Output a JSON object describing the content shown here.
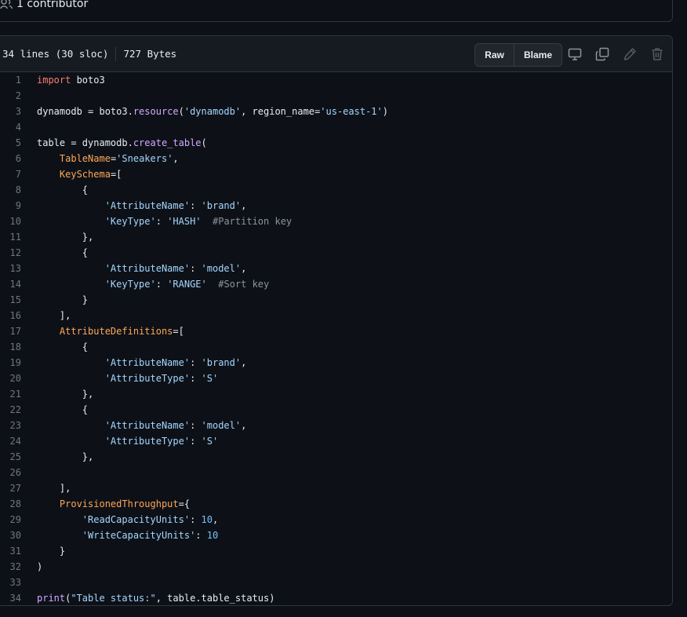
{
  "contributors": {
    "text": "1 contributor"
  },
  "file_header": {
    "lines": "34 lines (30 sloc)",
    "size": "727 Bytes",
    "raw_label": "Raw",
    "blame_label": "Blame",
    "icons": [
      "desktop-icon",
      "copy-icon",
      "pencil-icon",
      "trash-icon"
    ]
  },
  "code_lines": [
    {
      "n": "1",
      "t": [
        {
          "c": "kw",
          "v": "import"
        },
        {
          "c": "",
          "v": " boto3"
        }
      ]
    },
    {
      "n": "2",
      "t": []
    },
    {
      "n": "3",
      "t": [
        {
          "c": "",
          "v": "dynamodb = boto3."
        },
        {
          "c": "fn",
          "v": "resource"
        },
        {
          "c": "",
          "v": "("
        },
        {
          "c": "str",
          "v": "'dynamodb'"
        },
        {
          "c": "",
          "v": ", region_name="
        },
        {
          "c": "str",
          "v": "'us-east-1'"
        },
        {
          "c": "",
          "v": ")"
        }
      ]
    },
    {
      "n": "4",
      "t": []
    },
    {
      "n": "5",
      "t": [
        {
          "c": "",
          "v": "table = dynamodb."
        },
        {
          "c": "fn",
          "v": "create_table"
        },
        {
          "c": "",
          "v": "("
        }
      ]
    },
    {
      "n": "6",
      "t": [
        {
          "c": "",
          "v": "    "
        },
        {
          "c": "param",
          "v": "TableName"
        },
        {
          "c": "",
          "v": "="
        },
        {
          "c": "str",
          "v": "'Sneakers'"
        },
        {
          "c": "",
          "v": ","
        }
      ]
    },
    {
      "n": "7",
      "t": [
        {
          "c": "",
          "v": "    "
        },
        {
          "c": "param",
          "v": "KeySchema"
        },
        {
          "c": "",
          "v": "=["
        }
      ]
    },
    {
      "n": "8",
      "t": [
        {
          "c": "",
          "v": "        {"
        }
      ]
    },
    {
      "n": "9",
      "t": [
        {
          "c": "",
          "v": "            "
        },
        {
          "c": "str",
          "v": "'AttributeName'"
        },
        {
          "c": "",
          "v": ": "
        },
        {
          "c": "str",
          "v": "'brand'"
        },
        {
          "c": "",
          "v": ","
        }
      ]
    },
    {
      "n": "10",
      "t": [
        {
          "c": "",
          "v": "            "
        },
        {
          "c": "str",
          "v": "'KeyType'"
        },
        {
          "c": "",
          "v": ": "
        },
        {
          "c": "str",
          "v": "'HASH'"
        },
        {
          "c": "",
          "v": "  "
        },
        {
          "c": "cm",
          "v": "#Partition key"
        }
      ]
    },
    {
      "n": "11",
      "t": [
        {
          "c": "",
          "v": "        },"
        }
      ]
    },
    {
      "n": "12",
      "t": [
        {
          "c": "",
          "v": "        {"
        }
      ]
    },
    {
      "n": "13",
      "t": [
        {
          "c": "",
          "v": "            "
        },
        {
          "c": "str",
          "v": "'AttributeName'"
        },
        {
          "c": "",
          "v": ": "
        },
        {
          "c": "str",
          "v": "'model'"
        },
        {
          "c": "",
          "v": ","
        }
      ]
    },
    {
      "n": "14",
      "t": [
        {
          "c": "",
          "v": "            "
        },
        {
          "c": "str",
          "v": "'KeyType'"
        },
        {
          "c": "",
          "v": ": "
        },
        {
          "c": "str",
          "v": "'RANGE'"
        },
        {
          "c": "",
          "v": "  "
        },
        {
          "c": "cm",
          "v": "#Sort key"
        }
      ]
    },
    {
      "n": "15",
      "t": [
        {
          "c": "",
          "v": "        }"
        }
      ]
    },
    {
      "n": "16",
      "t": [
        {
          "c": "",
          "v": "    ],"
        }
      ]
    },
    {
      "n": "17",
      "t": [
        {
          "c": "",
          "v": "    "
        },
        {
          "c": "param",
          "v": "AttributeDefinitions"
        },
        {
          "c": "",
          "v": "=["
        }
      ]
    },
    {
      "n": "18",
      "t": [
        {
          "c": "",
          "v": "        {"
        }
      ]
    },
    {
      "n": "19",
      "t": [
        {
          "c": "",
          "v": "            "
        },
        {
          "c": "str",
          "v": "'AttributeName'"
        },
        {
          "c": "",
          "v": ": "
        },
        {
          "c": "str",
          "v": "'brand'"
        },
        {
          "c": "",
          "v": ","
        }
      ]
    },
    {
      "n": "20",
      "t": [
        {
          "c": "",
          "v": "            "
        },
        {
          "c": "str",
          "v": "'AttributeType'"
        },
        {
          "c": "",
          "v": ": "
        },
        {
          "c": "str",
          "v": "'S'"
        }
      ]
    },
    {
      "n": "21",
      "t": [
        {
          "c": "",
          "v": "        },"
        }
      ]
    },
    {
      "n": "22",
      "t": [
        {
          "c": "",
          "v": "        {"
        }
      ]
    },
    {
      "n": "23",
      "t": [
        {
          "c": "",
          "v": "            "
        },
        {
          "c": "str",
          "v": "'AttributeName'"
        },
        {
          "c": "",
          "v": ": "
        },
        {
          "c": "str",
          "v": "'model'"
        },
        {
          "c": "",
          "v": ","
        }
      ]
    },
    {
      "n": "24",
      "t": [
        {
          "c": "",
          "v": "            "
        },
        {
          "c": "str",
          "v": "'AttributeType'"
        },
        {
          "c": "",
          "v": ": "
        },
        {
          "c": "str",
          "v": "'S'"
        }
      ]
    },
    {
      "n": "25",
      "t": [
        {
          "c": "",
          "v": "        },"
        }
      ]
    },
    {
      "n": "26",
      "t": []
    },
    {
      "n": "27",
      "t": [
        {
          "c": "",
          "v": "    ],"
        }
      ]
    },
    {
      "n": "28",
      "t": [
        {
          "c": "",
          "v": "    "
        },
        {
          "c": "param",
          "v": "ProvisionedThroughput"
        },
        {
          "c": "",
          "v": "={"
        }
      ]
    },
    {
      "n": "29",
      "t": [
        {
          "c": "",
          "v": "        "
        },
        {
          "c": "str",
          "v": "'ReadCapacityUnits'"
        },
        {
          "c": "",
          "v": ": "
        },
        {
          "c": "num",
          "v": "10"
        },
        {
          "c": "",
          "v": ","
        }
      ]
    },
    {
      "n": "30",
      "t": [
        {
          "c": "",
          "v": "        "
        },
        {
          "c": "str",
          "v": "'WriteCapacityUnits'"
        },
        {
          "c": "",
          "v": ": "
        },
        {
          "c": "num",
          "v": "10"
        }
      ]
    },
    {
      "n": "31",
      "t": [
        {
          "c": "",
          "v": "    }"
        }
      ]
    },
    {
      "n": "32",
      "t": [
        {
          "c": "",
          "v": ")"
        }
      ]
    },
    {
      "n": "33",
      "t": []
    },
    {
      "n": "34",
      "t": [
        {
          "c": "fn",
          "v": "print"
        },
        {
          "c": "",
          "v": "("
        },
        {
          "c": "str",
          "v": "\"Table status:\""
        },
        {
          "c": "",
          "v": ", table.table_status)"
        }
      ]
    }
  ]
}
